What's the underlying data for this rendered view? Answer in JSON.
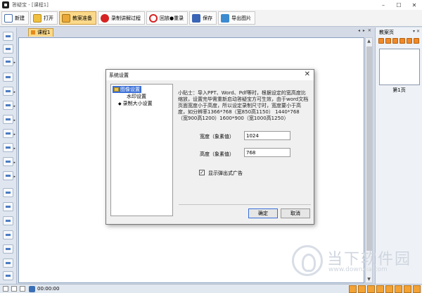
{
  "window": {
    "title": "答疑宝 - [课程1]"
  },
  "toolbar": [
    {
      "id": "new",
      "label": "新建",
      "icon": "new-doc-icon"
    },
    {
      "id": "open",
      "label": "打开",
      "icon": "folder-open-icon"
    },
    {
      "id": "prep",
      "label": "教案准备",
      "icon": "lesson-prep-icon",
      "active": true
    },
    {
      "id": "record",
      "label": "录制讲解过程",
      "icon": "record-icon"
    },
    {
      "id": "playback",
      "label": "回放●重录",
      "icon": "playback-icon"
    },
    {
      "id": "save",
      "label": "保存",
      "icon": "save-icon"
    },
    {
      "id": "export",
      "label": "导出图片",
      "icon": "export-image-icon"
    }
  ],
  "document": {
    "tab_label": "课程1"
  },
  "pages_panel": {
    "title": "教案页",
    "pages": [
      {
        "label": "第1页"
      }
    ]
  },
  "statusbar": {
    "time": "00:00:00"
  },
  "dialog": {
    "title": "系统设置",
    "tree": [
      "图像设置",
      "水印设置",
      "录制大小设置"
    ],
    "tip": "小贴士：导入PPT、Word、Pdf等时，根据设定的宽高度比缩放，设置完毕需重新启动答疑宝方可生效，由于word文档页面宽度小于高度，所以设定录制尺寸时，宽度要小于高度，如分辨率1366*768（宽850高1150） 1440*768（宽900高1200）1600*900（宽1000高1250）",
    "width_label": "宽度（象素值）",
    "width_value": "1024",
    "height_label": "高度（象素值）",
    "height_value": "768",
    "popup_ad_checked": true,
    "popup_ad_label": "显示弹出式广告",
    "ok_label": "确定",
    "cancel_label": "取消"
  },
  "watermark": {
    "title": "当下软件园",
    "url": "www.downxia.com"
  },
  "colors": {
    "accent": "#fbd98a",
    "selection": "#3a6fd8",
    "frame": "#d4dbe6"
  }
}
